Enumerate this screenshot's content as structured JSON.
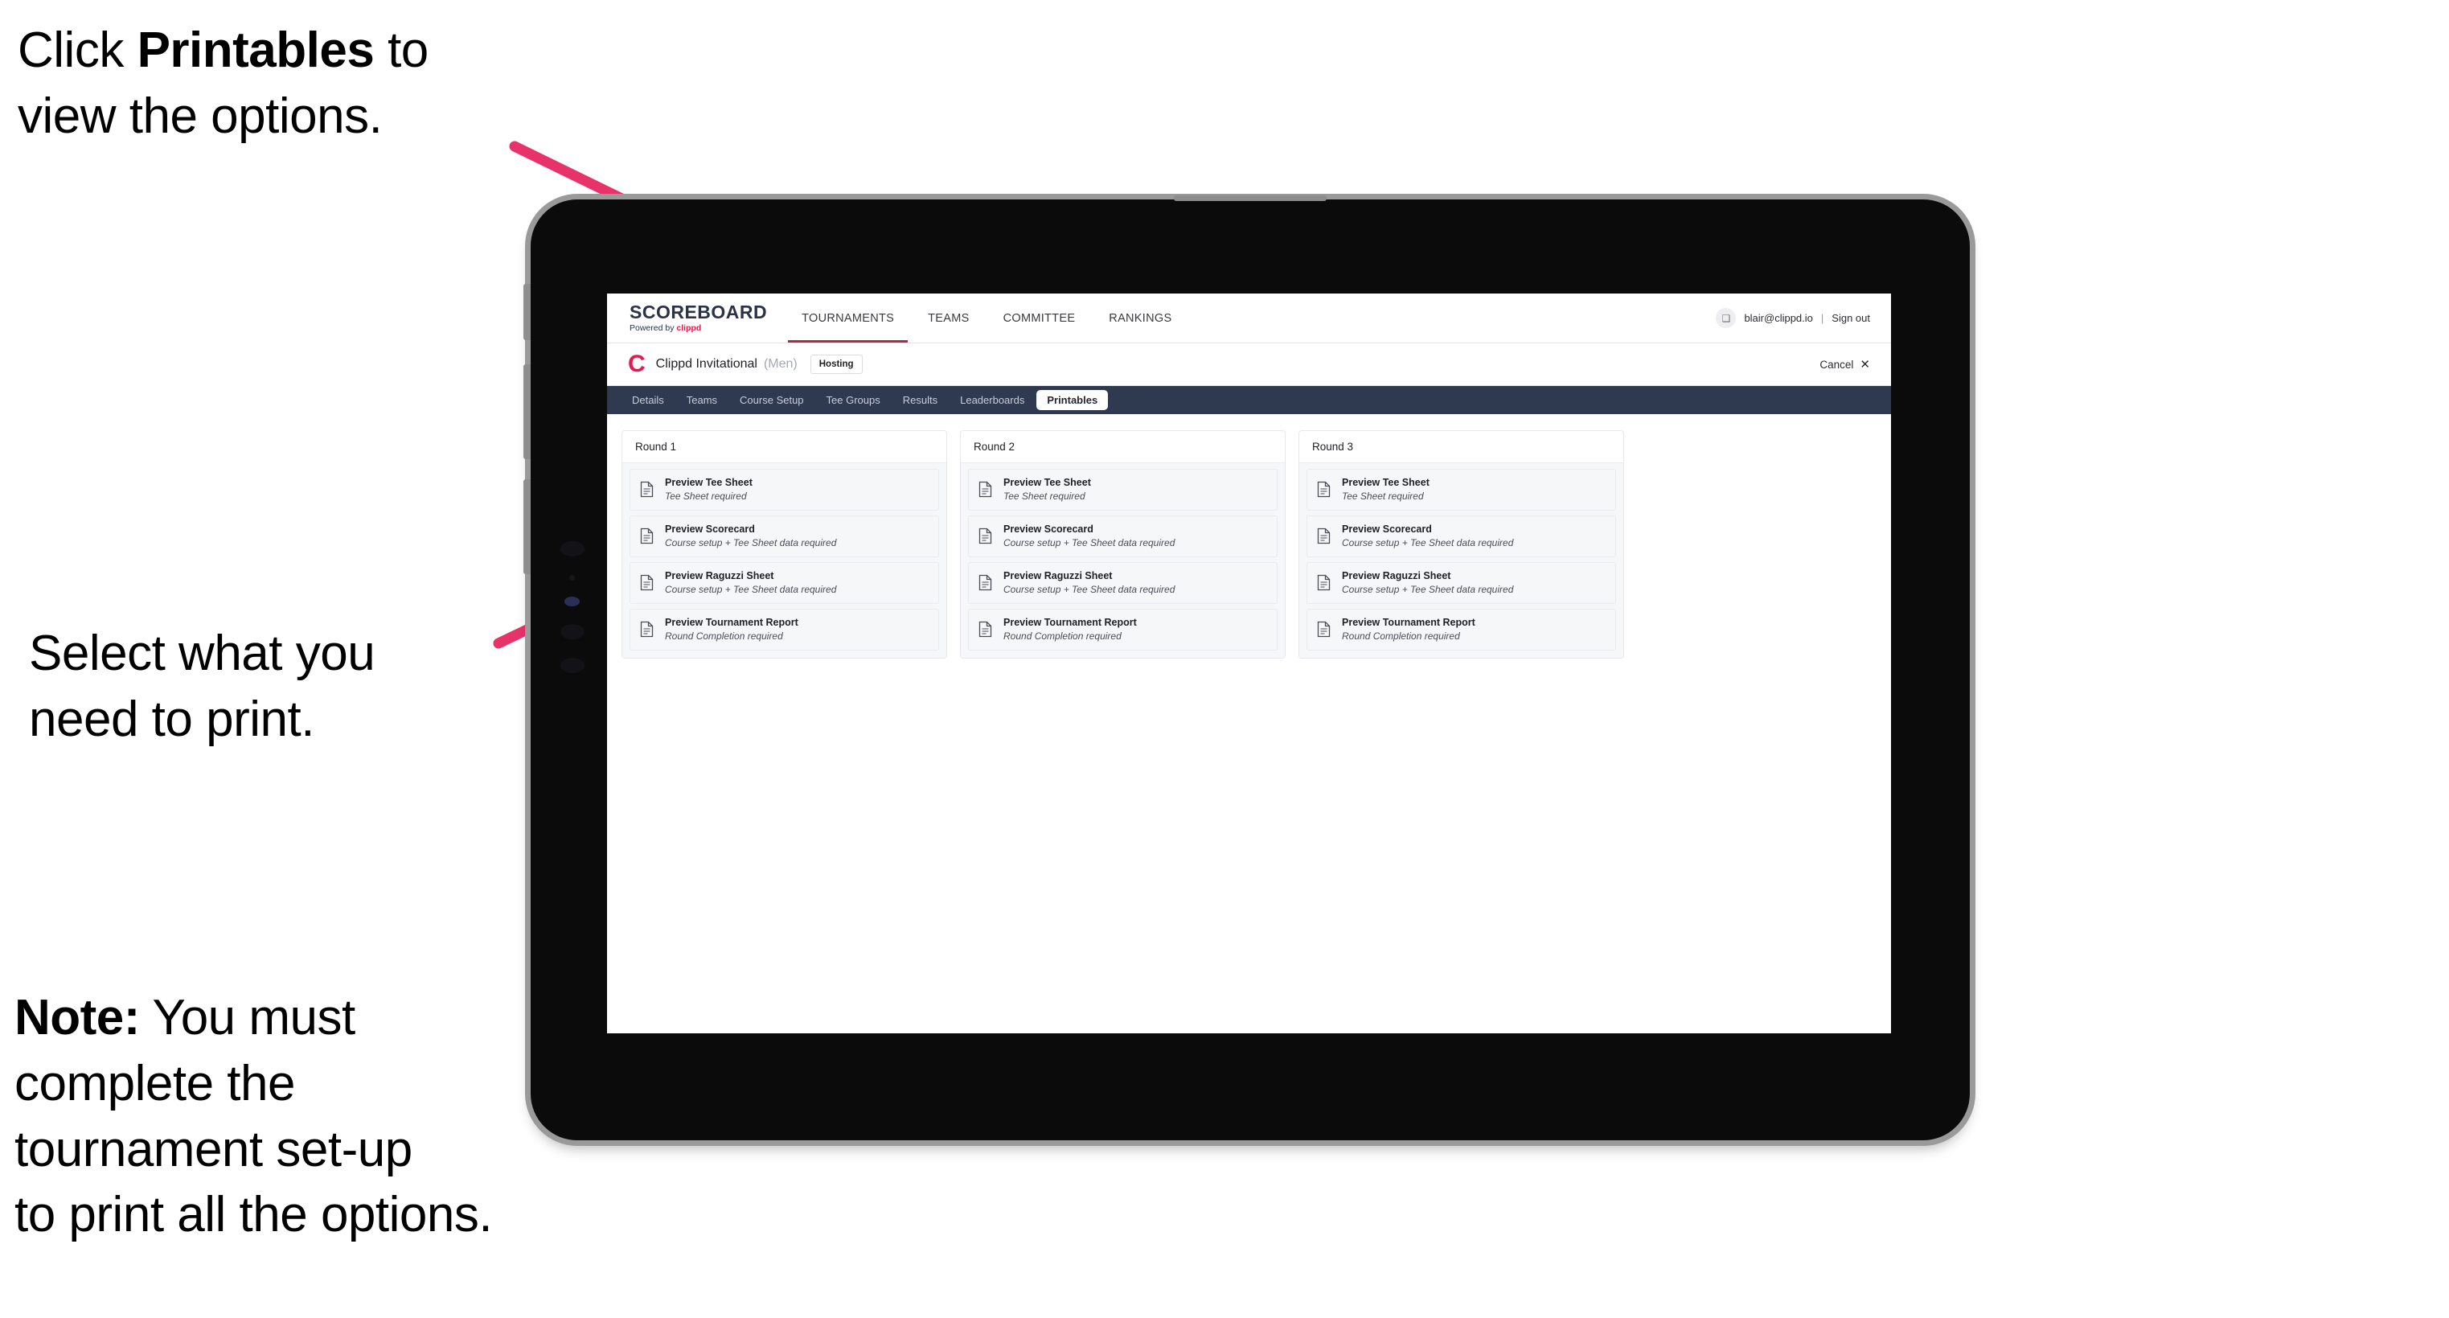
{
  "annotations": {
    "top": {
      "prefix": "Click ",
      "bold": "Printables",
      "suffix": " to\nview the options."
    },
    "middle": {
      "text": "Select what you\n need to print."
    },
    "note": {
      "bold": "Note:",
      "text": " You must\ncomplete the\ntournament set-up\nto print all the options."
    }
  },
  "colors": {
    "arrow_pink": "#e8336a",
    "brand_pink": "#e5194b",
    "subnav_navy": "#2f3a50",
    "topnav_underline": "#a03049"
  },
  "app": {
    "brand": {
      "title": "SCOREBOARD",
      "powered_prefix": "Powered by ",
      "powered_name": "clippd"
    },
    "topnav": [
      {
        "label": "TOURNAMENTS",
        "active": true
      },
      {
        "label": "TEAMS",
        "active": false
      },
      {
        "label": "COMMITTEE",
        "active": false
      },
      {
        "label": "RANKINGS",
        "active": false
      }
    ],
    "account": {
      "avatar_glyph": "❑",
      "email": "blair@clippd.io",
      "separator": "|",
      "sign_out": "Sign out"
    },
    "tournament": {
      "logo_letter": "C",
      "name": "Clippd Invitational",
      "gender": "(Men)",
      "badge": "Hosting",
      "cancel_label": "Cancel",
      "cancel_icon": "✕"
    },
    "subnav": [
      {
        "label": "Details",
        "active": false
      },
      {
        "label": "Teams",
        "active": false
      },
      {
        "label": "Course Setup",
        "active": false
      },
      {
        "label": "Tee Groups",
        "active": false
      },
      {
        "label": "Results",
        "active": false
      },
      {
        "label": "Leaderboards",
        "active": false
      },
      {
        "label": "Printables",
        "active": true
      }
    ],
    "rounds": [
      {
        "title": "Round 1",
        "items": [
          {
            "title": "Preview Tee Sheet",
            "sub": "Tee Sheet required"
          },
          {
            "title": "Preview Scorecard",
            "sub": "Course setup + Tee Sheet data required"
          },
          {
            "title": "Preview Raguzzi Sheet",
            "sub": "Course setup + Tee Sheet data required"
          },
          {
            "title": "Preview Tournament Report",
            "sub": "Round Completion required"
          }
        ]
      },
      {
        "title": "Round 2",
        "items": [
          {
            "title": "Preview Tee Sheet",
            "sub": "Tee Sheet required"
          },
          {
            "title": "Preview Scorecard",
            "sub": "Course setup + Tee Sheet data required"
          },
          {
            "title": "Preview Raguzzi Sheet",
            "sub": "Course setup + Tee Sheet data required"
          },
          {
            "title": "Preview Tournament Report",
            "sub": "Round Completion required"
          }
        ]
      },
      {
        "title": "Round 3",
        "items": [
          {
            "title": "Preview Tee Sheet",
            "sub": "Tee Sheet required"
          },
          {
            "title": "Preview Scorecard",
            "sub": "Course setup + Tee Sheet data required"
          },
          {
            "title": "Preview Raguzzi Sheet",
            "sub": "Course setup + Tee Sheet data required"
          },
          {
            "title": "Preview Tournament Report",
            "sub": "Round Completion required"
          }
        ]
      }
    ]
  }
}
